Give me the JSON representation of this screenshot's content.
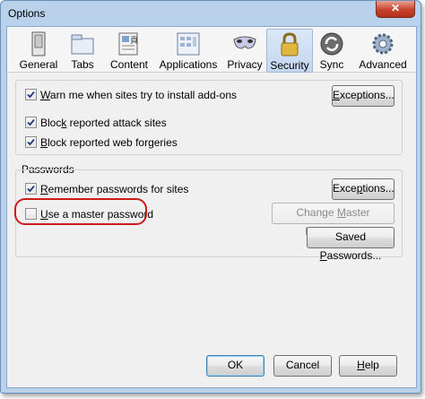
{
  "window": {
    "title": "Options",
    "close_glyph": "✕"
  },
  "tabs": [
    {
      "label": "General",
      "icon": "general-icon"
    },
    {
      "label": "Tabs",
      "icon": "tabs-icon"
    },
    {
      "label": "Content",
      "icon": "content-icon"
    },
    {
      "label": "Applications",
      "icon": "applications-icon"
    },
    {
      "label": "Privacy",
      "icon": "privacy-mask-icon"
    },
    {
      "label": "Security",
      "icon": "padlock-icon",
      "selected": true
    },
    {
      "label": "Sync",
      "icon": "sync-icon"
    },
    {
      "label": "Advanced",
      "icon": "gear-icon"
    }
  ],
  "security": {
    "addons": {
      "label_pre": "",
      "label_ul": "W",
      "label_post": "arn me when sites try to install add-ons",
      "checked": true
    },
    "exceptions1": {
      "pre": "",
      "ul": "E",
      "post": "xceptions..."
    },
    "attack": {
      "label_pre": "Bloc",
      "label_ul": "k",
      "label_post": " reported attack sites",
      "checked": true
    },
    "forgeries": {
      "label_pre": "",
      "label_ul": "B",
      "label_post": "lock reported web forgeries",
      "checked": true
    }
  },
  "passwords": {
    "group_label": "Passwords",
    "remember": {
      "label_pre": "",
      "label_ul": "R",
      "label_post": "emember passwords for sites",
      "checked": true
    },
    "exceptions2": {
      "pre": "Exce",
      "ul": "p",
      "post": "tions..."
    },
    "master": {
      "label_pre": "",
      "label_ul": "U",
      "label_post": "se a master password",
      "checked": false
    },
    "change_master": {
      "pre": "Change ",
      "ul": "M",
      "post": "aster Password..."
    },
    "saved": {
      "pre": "Saved ",
      "ul": "P",
      "post": "asswords..."
    }
  },
  "footer": {
    "ok": "OK",
    "cancel": "Cancel",
    "help_ul": "H",
    "help_post": "elp"
  },
  "colors": {
    "accent_selected_tab": "#c4d7ef",
    "annotation_circle": "#cc1b1b"
  }
}
